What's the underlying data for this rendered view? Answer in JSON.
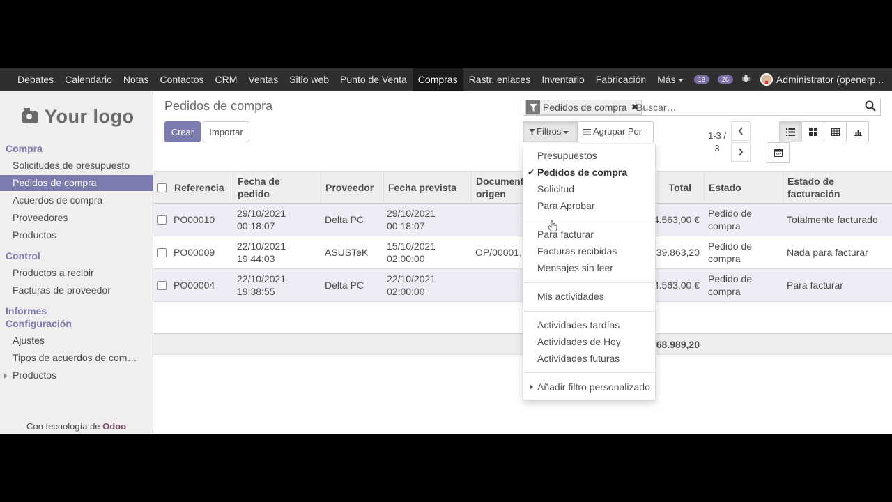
{
  "topnav": {
    "items": [
      {
        "label": "Debates"
      },
      {
        "label": "Calendario"
      },
      {
        "label": "Notas"
      },
      {
        "label": "Contactos"
      },
      {
        "label": "CRM"
      },
      {
        "label": "Ventas"
      },
      {
        "label": "Sitio web"
      },
      {
        "label": "Punto de Venta"
      },
      {
        "label": "Compras",
        "active": true
      },
      {
        "label": "Rastr. enlaces"
      },
      {
        "label": "Inventario"
      },
      {
        "label": "Fabricación"
      }
    ],
    "more_label": "Más",
    "messages_count": "19",
    "chat_count": "26",
    "user_name": "Administrator (openerp..."
  },
  "sidebar": {
    "logo_text": "Your logo",
    "sections": {
      "compra": "Compra",
      "control": "Control",
      "informes": "Informes",
      "configuracion": "Configuración"
    },
    "items": {
      "solicitudes": "Solicitudes de presupuesto",
      "pedidos": "Pedidos de compra",
      "acuerdos": "Acuerdos de compra",
      "proveedores": "Proveedores",
      "productos": "Productos",
      "productos_recibir": "Productos a recibir",
      "facturas_proveedor": "Facturas de proveedor",
      "ajustes": "Ajustes",
      "tipos_acuerdos": "Tipos de acuerdos de com…",
      "productos_conf": "Productos"
    },
    "powered_prefix": "Con tecnología de",
    "powered_brand": "Odoo"
  },
  "main": {
    "title": "Pedidos de compra",
    "create_label": "Crear",
    "import_label": "Importar",
    "search": {
      "facet_label": "Pedidos de compra",
      "placeholder": "Buscar…"
    },
    "filters_label": "Filtros",
    "groupby_label": "Agrupar Por",
    "pager_line1": "1-3 /",
    "pager_line2": "3"
  },
  "table": {
    "headers": {
      "referencia": "Referencia",
      "fecha_pedido_1": "Fecha de",
      "fecha_pedido_2": "pedido",
      "proveedor": "Proveedor",
      "fecha_prevista": "Fecha prevista",
      "documento_1": "Documento",
      "documento_2": "origen",
      "total": "Total",
      "estado": "Estado",
      "estado_fact_1": "Estado de",
      "estado_fact_2": "facturación"
    },
    "rows": [
      {
        "ref": "PO00010",
        "fecha1": "29/10/2021",
        "fecha2": "00:18:07",
        "proveedor": "Delta PC",
        "prev1": "29/10/2021",
        "prev2": "00:18:07",
        "origen": "",
        "total": "4.563,00 €",
        "estado1": "Pedido de",
        "estado2": "compra",
        "facturacion": "Totalmente facturado"
      },
      {
        "ref": "PO00009",
        "fecha1": "22/10/2021",
        "fecha2": "19:44:03",
        "proveedor": "ASUSTeK",
        "prev1": "15/10/2021",
        "prev2": "02:00:00",
        "origen": "OP/00001, C",
        "total": "$ 39.863,20",
        "estado1": "Pedido de",
        "estado2": "compra",
        "facturacion": "Nada para facturar"
      },
      {
        "ref": "PO00004",
        "fecha1": "22/10/2021",
        "fecha2": "19:38:55",
        "proveedor": "Delta PC",
        "prev1": "22/10/2021",
        "prev2": "02:00:00",
        "origen": "",
        "total": "4.563,00 €",
        "estado1": "Pedido de",
        "estado2": "compra",
        "facturacion": "Para facturar"
      }
    ],
    "footer_total": "68.989,20"
  },
  "filters_dropdown": {
    "presupuestos": "Presupuestos",
    "pedidos_compra": "Pedidos de compra",
    "solicitud": "Solicitud",
    "para_aprobar": "Para Aprobar",
    "para_facturar": "Para facturar",
    "facturas_recibidas": "Facturas recibidas",
    "mensajes_sin_leer": "Mensajes sin leer",
    "mis_actividades": "Mis actividades",
    "actividades_tardias": "Actividades tardías",
    "actividades_hoy": "Actividades de Hoy",
    "actividades_futuras": "Actividades futuras",
    "anadir_filtro": "Añadir filtro personalizado"
  },
  "colors": {
    "accent": "#7c7bad",
    "topbar": "#2f2f2f",
    "row_highlight": "#eeedf6"
  }
}
